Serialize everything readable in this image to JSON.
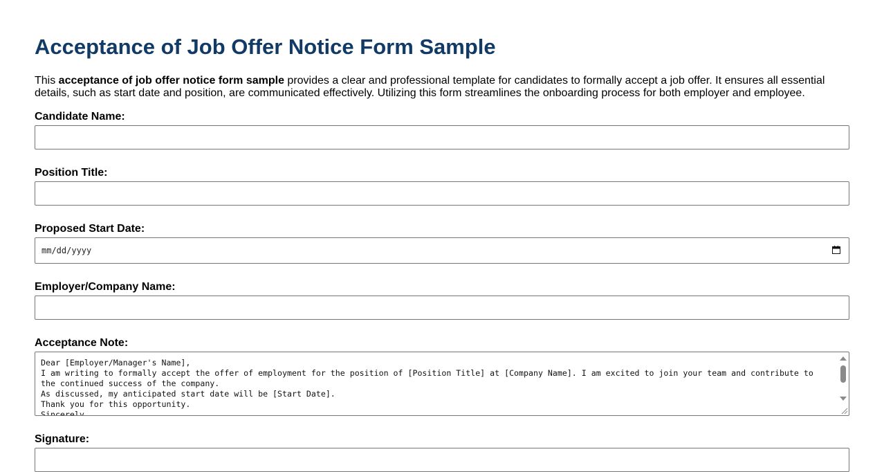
{
  "page": {
    "title": "Acceptance of Job Offer Notice Form Sample",
    "intro": {
      "prefix": "This ",
      "bold": "acceptance of job offer notice form sample",
      "suffix": " provides a clear and professional template for candidates to formally accept a job offer. It ensures all essential details, such as start date and position, are communicated effectively. Utilizing this form streamlines the onboarding process for both employer and employee."
    }
  },
  "form": {
    "candidate_name": {
      "label": "Candidate Name:",
      "value": ""
    },
    "position_title": {
      "label": "Position Title:",
      "value": ""
    },
    "start_date": {
      "label": "Proposed Start Date:",
      "placeholder": "mm/dd/yyyy",
      "icon": "calendar-icon"
    },
    "company_name": {
      "label": "Employer/Company Name:",
      "value": ""
    },
    "acceptance_note": {
      "label": "Acceptance Note:",
      "value": "Dear [Employer/Manager's Name],\nI am writing to formally accept the offer of employment for the position of [Position Title] at [Company Name]. I am excited to join your team and contribute to the continued success of the company.\nAs discussed, my anticipated start date will be [Start Date].\nThank you for this opportunity.\nSincerely,"
    },
    "signature": {
      "label": "Signature:"
    }
  },
  "colors": {
    "title": "#123a66",
    "border": "#767676",
    "scrollbar": "#8a8a8a"
  }
}
